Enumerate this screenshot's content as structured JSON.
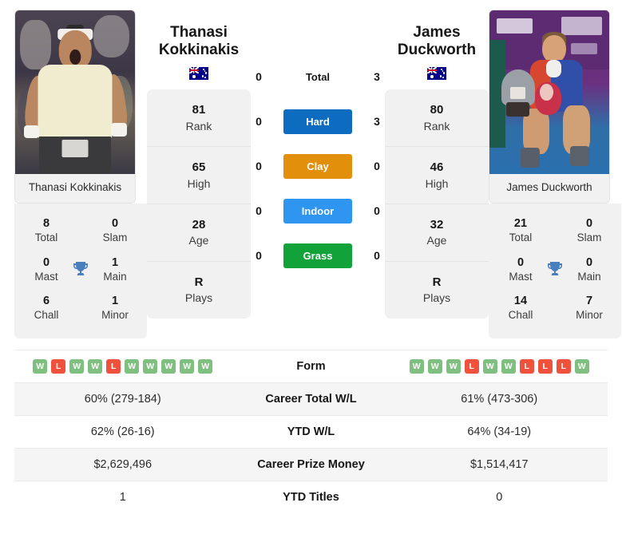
{
  "players": {
    "left": {
      "name_line1": "Thanasi",
      "name_line2": "Kokkinakis",
      "full_name": "Thanasi Kokkinakis",
      "country": "Australia",
      "photo_alt": "Thanasi Kokkinakis celebrating",
      "stats": [
        {
          "value": "81",
          "label": "Rank"
        },
        {
          "value": "65",
          "label": "High"
        },
        {
          "value": "28",
          "label": "Age"
        },
        {
          "value": "R",
          "label": "Plays"
        }
      ],
      "titles": {
        "total": "8",
        "slam": "0",
        "mast": "0",
        "main": "1",
        "chall": "6",
        "minor": "1"
      },
      "form": [
        "W",
        "L",
        "W",
        "W",
        "L",
        "W",
        "W",
        "W",
        "W",
        "W"
      ],
      "career_wl": "60% (279-184)",
      "ytd_wl": "62% (26-16)",
      "prize_money": "$2,629,496",
      "ytd_titles": "1"
    },
    "right": {
      "name_line1": "James",
      "name_line2": "Duckworth",
      "full_name": "James Duckworth",
      "country": "Australia",
      "photo_alt": "James Duckworth holding trophy",
      "stats": [
        {
          "value": "80",
          "label": "Rank"
        },
        {
          "value": "46",
          "label": "High"
        },
        {
          "value": "32",
          "label": "Age"
        },
        {
          "value": "R",
          "label": "Plays"
        }
      ],
      "titles": {
        "total": "21",
        "slam": "0",
        "mast": "0",
        "main": "0",
        "chall": "14",
        "minor": "7"
      },
      "form": [
        "W",
        "W",
        "W",
        "L",
        "W",
        "W",
        "L",
        "L",
        "L",
        "W"
      ],
      "career_wl": "61% (473-306)",
      "ytd_wl": "64% (34-19)",
      "prize_money": "$1,514,417",
      "ytd_titles": "0"
    }
  },
  "titles_labels": {
    "total": "Total",
    "slam": "Slam",
    "mast": "Mast",
    "main": "Main",
    "chall": "Chall",
    "minor": "Minor"
  },
  "h2h": [
    {
      "surface": "Total",
      "left": "0",
      "right": "3",
      "color": "none"
    },
    {
      "surface": "Hard",
      "left": "0",
      "right": "3",
      "color": "#0d6cc0"
    },
    {
      "surface": "Clay",
      "left": "0",
      "right": "0",
      "color": "#e2900b"
    },
    {
      "surface": "Indoor",
      "left": "0",
      "right": "0",
      "color": "#2e95f0"
    },
    {
      "surface": "Grass",
      "left": "0",
      "right": "0",
      "color": "#11a23a"
    }
  ],
  "table_rows": [
    {
      "label": "Form",
      "type": "form",
      "left": "",
      "right": ""
    },
    {
      "label": "Career Total W/L",
      "type": "text",
      "left": "60% (279-184)",
      "right": "61% (473-306)"
    },
    {
      "label": "YTD W/L",
      "type": "text",
      "left": "62% (26-16)",
      "right": "64% (34-19)"
    },
    {
      "label": "Career Prize Money",
      "type": "text",
      "left": "$2,629,496",
      "right": "$1,514,417"
    },
    {
      "label": "YTD Titles",
      "type": "text",
      "left": "1",
      "right": "0"
    }
  ],
  "colors": {
    "hard": "#0d6cc0",
    "clay": "#e2900b",
    "indoor": "#2e95f0",
    "grass": "#11a23a",
    "win": "#7fbf7f",
    "loss": "#f0513c",
    "trophy": "#4a7fbd"
  },
  "icons": {
    "trophy": "trophy-icon",
    "flag": "flag-australia-icon"
  }
}
